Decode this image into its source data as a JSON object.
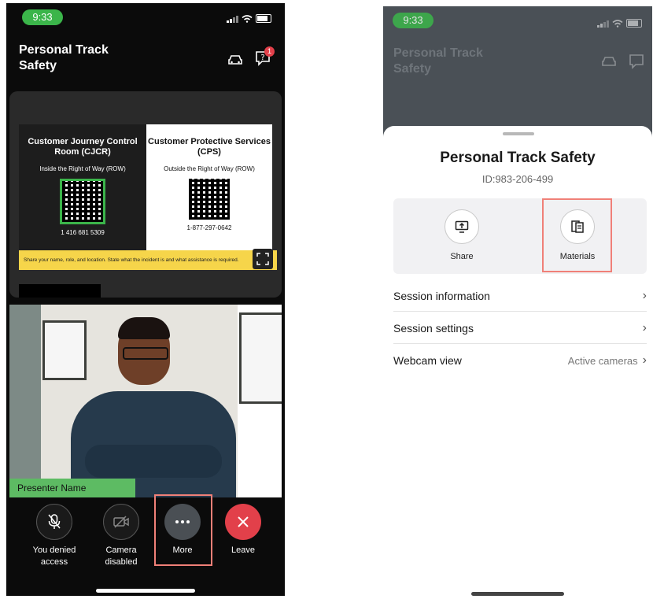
{
  "status_bar": {
    "time": "9:33"
  },
  "left_screen": {
    "title": "Personal Track Safety",
    "notification_count": "1",
    "slide": {
      "left_heading": "Customer Journey Control Room (CJCR)",
      "left_subtitle": "Inside the Right of Way (ROW)",
      "left_phone": "1 416 681 5309",
      "right_heading": "Customer Protective Services (CPS)",
      "right_subtitle": "Outside the Right of Way (ROW)",
      "right_phone": "1-877-297-0642",
      "banner": "Share your name, role, and location. State what the incident is and what assistance is required."
    },
    "presenter_name": "Presenter Name",
    "controls": {
      "mic_label": "You denied access",
      "camera_label": "Camera disabled",
      "more_label": "More",
      "leave_label": "Leave"
    }
  },
  "right_screen": {
    "title": "Personal Track Safety",
    "session_id": "ID:983-206-499",
    "actions": {
      "share_label": "Share",
      "materials_label": "Materials"
    },
    "menu": {
      "session_information": "Session information",
      "session_settings": "Session settings",
      "webcam_view": "Webcam view",
      "webcam_value": "Active cameras"
    }
  },
  "colors": {
    "accent_green": "#3bb54a",
    "leave_red": "#e2404a",
    "highlight": "#f08078"
  }
}
